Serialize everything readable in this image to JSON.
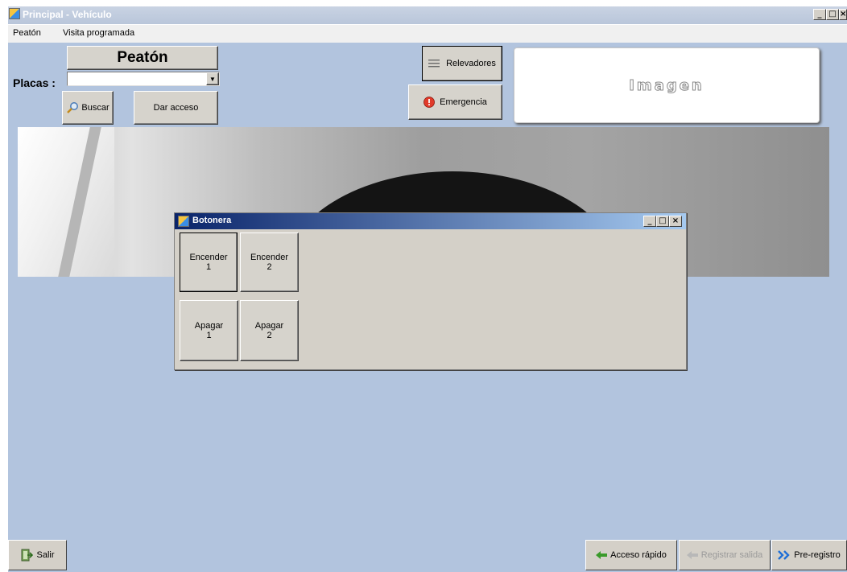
{
  "window": {
    "title": "Principal - Vehículo",
    "controls": {
      "minimize": "_",
      "maximize": "□",
      "close": "×"
    }
  },
  "menu": {
    "items": [
      "Peatón",
      "Visita programada"
    ]
  },
  "form": {
    "mode_label": "Peatón",
    "placas_label": "Placas :",
    "placas_value": "",
    "search_label": "Buscar",
    "grant_access_label": "Dar acceso",
    "relays_label": "Relevadores",
    "emergency_label": "Emergencia",
    "image_label": "Imagen"
  },
  "botonera": {
    "title": "Botonera",
    "buttons": {
      "on1": [
        "Encender",
        "1"
      ],
      "on2": [
        "Encender",
        "2"
      ],
      "off1": [
        "Apagar",
        "1"
      ],
      "off2": [
        "Apagar",
        "2"
      ]
    }
  },
  "status": {
    "exit_label": "Salir",
    "quick_access_label": "Acceso rápido",
    "register_exit_label": "Registrar salida",
    "preregister_label": "Pre-registro"
  },
  "colors": {
    "client_bg": "#b2c4de",
    "titlebar_active": "#0a246a",
    "button_face": "#d4d0c8",
    "emergency_red": "#e03a2a",
    "quick_access_green": "#3a9a2a",
    "preregister_blue": "#1f6fd6"
  },
  "icons": {
    "app": "app-icon",
    "search": "magnifier-icon",
    "relays": "list-lines-icon",
    "emergency": "alert-circle-icon",
    "exit": "exit-door-icon",
    "quick_access": "green-arrow-icon",
    "register_exit": "gray-arrow-icon",
    "preregister": "double-chevron-icon"
  }
}
